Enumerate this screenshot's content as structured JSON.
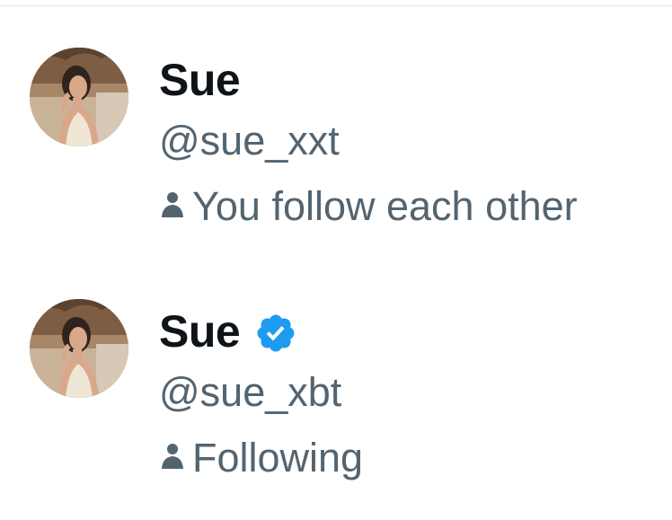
{
  "users": [
    {
      "display_name": "Sue",
      "handle": "@sue_xxt",
      "verified": false,
      "relationship": "You follow each other",
      "avatar_icon": "profile-photo"
    },
    {
      "display_name": "Sue",
      "handle": "@sue_xbt",
      "verified": true,
      "relationship": "Following",
      "avatar_icon": "profile-photo"
    }
  ],
  "colors": {
    "name": "#0f1419",
    "secondary": "#536471",
    "verified_badge": "#1d9bf0",
    "divider": "#e3e7ea"
  }
}
